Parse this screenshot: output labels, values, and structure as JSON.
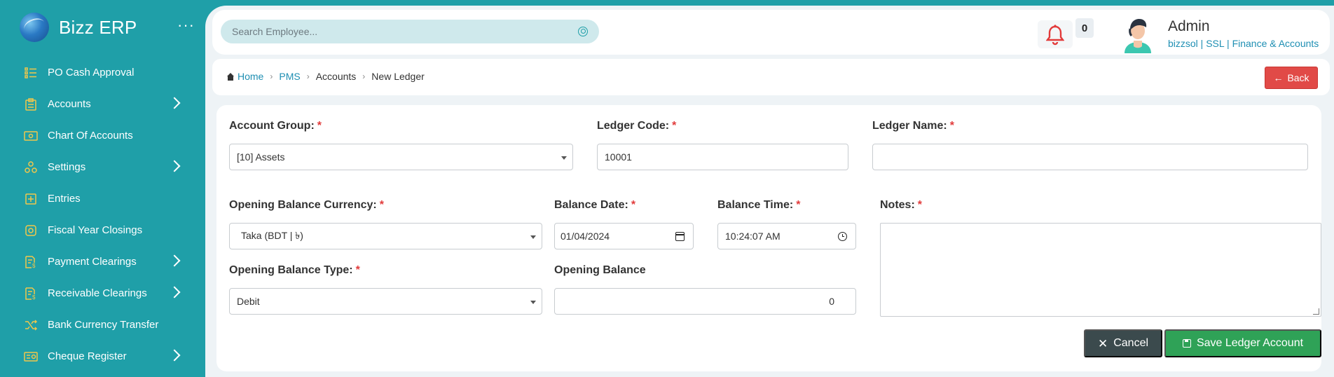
{
  "brand": {
    "name": "Bizz ERP"
  },
  "sidebar": {
    "items": [
      {
        "label": "PO Cash Approval",
        "icon": "list-icon",
        "expandable": false
      },
      {
        "label": "Accounts",
        "icon": "clipboard-icon",
        "expandable": true
      },
      {
        "label": "Chart Of Accounts",
        "icon": "money-icon",
        "expandable": false
      },
      {
        "label": "Settings",
        "icon": "settings-icon",
        "expandable": true
      },
      {
        "label": "Entries",
        "icon": "plus-square-icon",
        "expandable": false
      },
      {
        "label": "Fiscal Year Closings",
        "icon": "circle-square-icon",
        "expandable": false
      },
      {
        "label": "Payment Clearings",
        "icon": "document-money-icon",
        "expandable": true
      },
      {
        "label": "Receivable Clearings",
        "icon": "document-money-icon",
        "expandable": true
      },
      {
        "label": "Bank Currency Transfer",
        "icon": "shuffle-icon",
        "expandable": false
      },
      {
        "label": "Cheque Register",
        "icon": "cheque-icon",
        "expandable": true
      }
    ]
  },
  "header": {
    "search_placeholder": "Search Employee...",
    "notification_count": "0",
    "user_name": "Admin",
    "user_role": "bizzsol | SSL  | Finance & Accounts"
  },
  "breadcrumb": {
    "home": "Home",
    "items": [
      "PMS",
      "Accounts",
      "New Ledger"
    ],
    "back_label": "Back"
  },
  "form": {
    "account_group_label": "Account Group:",
    "account_group_value": "[10] Assets",
    "ledger_code_label": "Ledger Code:",
    "ledger_code_value": "10001",
    "ledger_name_label": "Ledger Name:",
    "ledger_name_value": "",
    "opening_currency_label": "Opening Balance Currency:",
    "opening_currency_value": "Taka (BDT | ৳)",
    "balance_date_label": "Balance Date:",
    "balance_date_value": "01/04/2024",
    "balance_time_label": "Balance Time:",
    "balance_time_value": "10:24:07 AM",
    "notes_label": "Notes:",
    "opening_type_label": "Opening Balance Type:",
    "opening_type_value": "Debit",
    "opening_balance_label": "Opening Balance",
    "opening_balance_value": "0",
    "cancel_label": "Cancel",
    "save_label": "Save Ledger Account"
  },
  "colors": {
    "sidebar": "#1f9fa8",
    "accent_icon": "#f1c74a",
    "back_button": "#e14a47",
    "save_button": "#2fa257",
    "cancel_button": "#3b4a4d",
    "required": "#e13b3b"
  }
}
